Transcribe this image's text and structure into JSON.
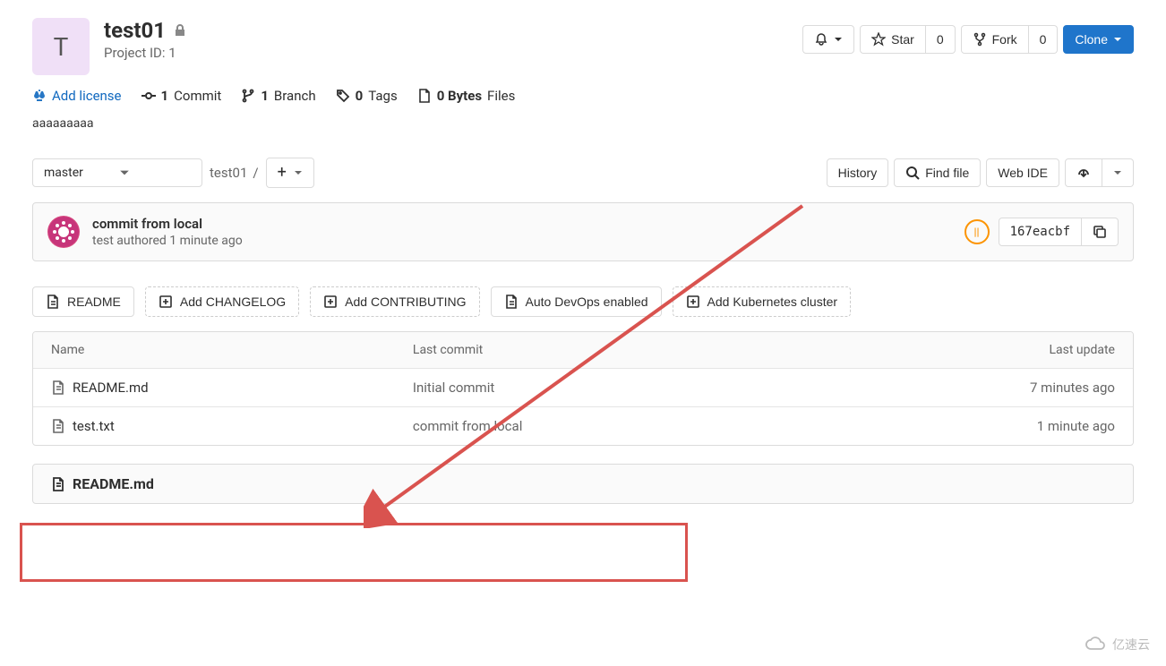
{
  "project": {
    "avatar_letter": "T",
    "name": "test01",
    "id_label": "Project ID: 1"
  },
  "header_actions": {
    "star_label": "Star",
    "star_count": "0",
    "fork_label": "Fork",
    "fork_count": "0",
    "clone_label": "Clone"
  },
  "stats": {
    "add_license": "Add license",
    "commits_count": "1",
    "commits_label": "Commit",
    "branches_count": "1",
    "branches_label": "Branch",
    "tags_count": "0",
    "tags_label": "Tags",
    "size_count": "0 Bytes",
    "size_label": "Files"
  },
  "description": "aaaaaaaaa",
  "tree": {
    "branch": "master",
    "breadcrumb": "test01",
    "breadcrumb_sep": "/",
    "history_label": "History",
    "find_file_label": "Find file",
    "webide_label": "Web IDE"
  },
  "commit": {
    "message": "commit from local",
    "author": "test authored 1 minute ago",
    "status": "||",
    "sha": "167eacbf"
  },
  "quick_actions": {
    "readme": "README",
    "changelog": "Add CHANGELOG",
    "contributing": "Add CONTRIBUTING",
    "autodevops": "Auto DevOps enabled",
    "kubernetes": "Add Kubernetes cluster"
  },
  "file_table": {
    "headers": {
      "name": "Name",
      "commit": "Last commit",
      "update": "Last update"
    },
    "rows": [
      {
        "name": "README.md",
        "commit": "Initial commit",
        "update": "7 minutes ago"
      },
      {
        "name": "test.txt",
        "commit": "commit from local",
        "update": "1 minute ago"
      }
    ]
  },
  "readme_panel": {
    "title": "README.md"
  },
  "watermark": "亿速云"
}
